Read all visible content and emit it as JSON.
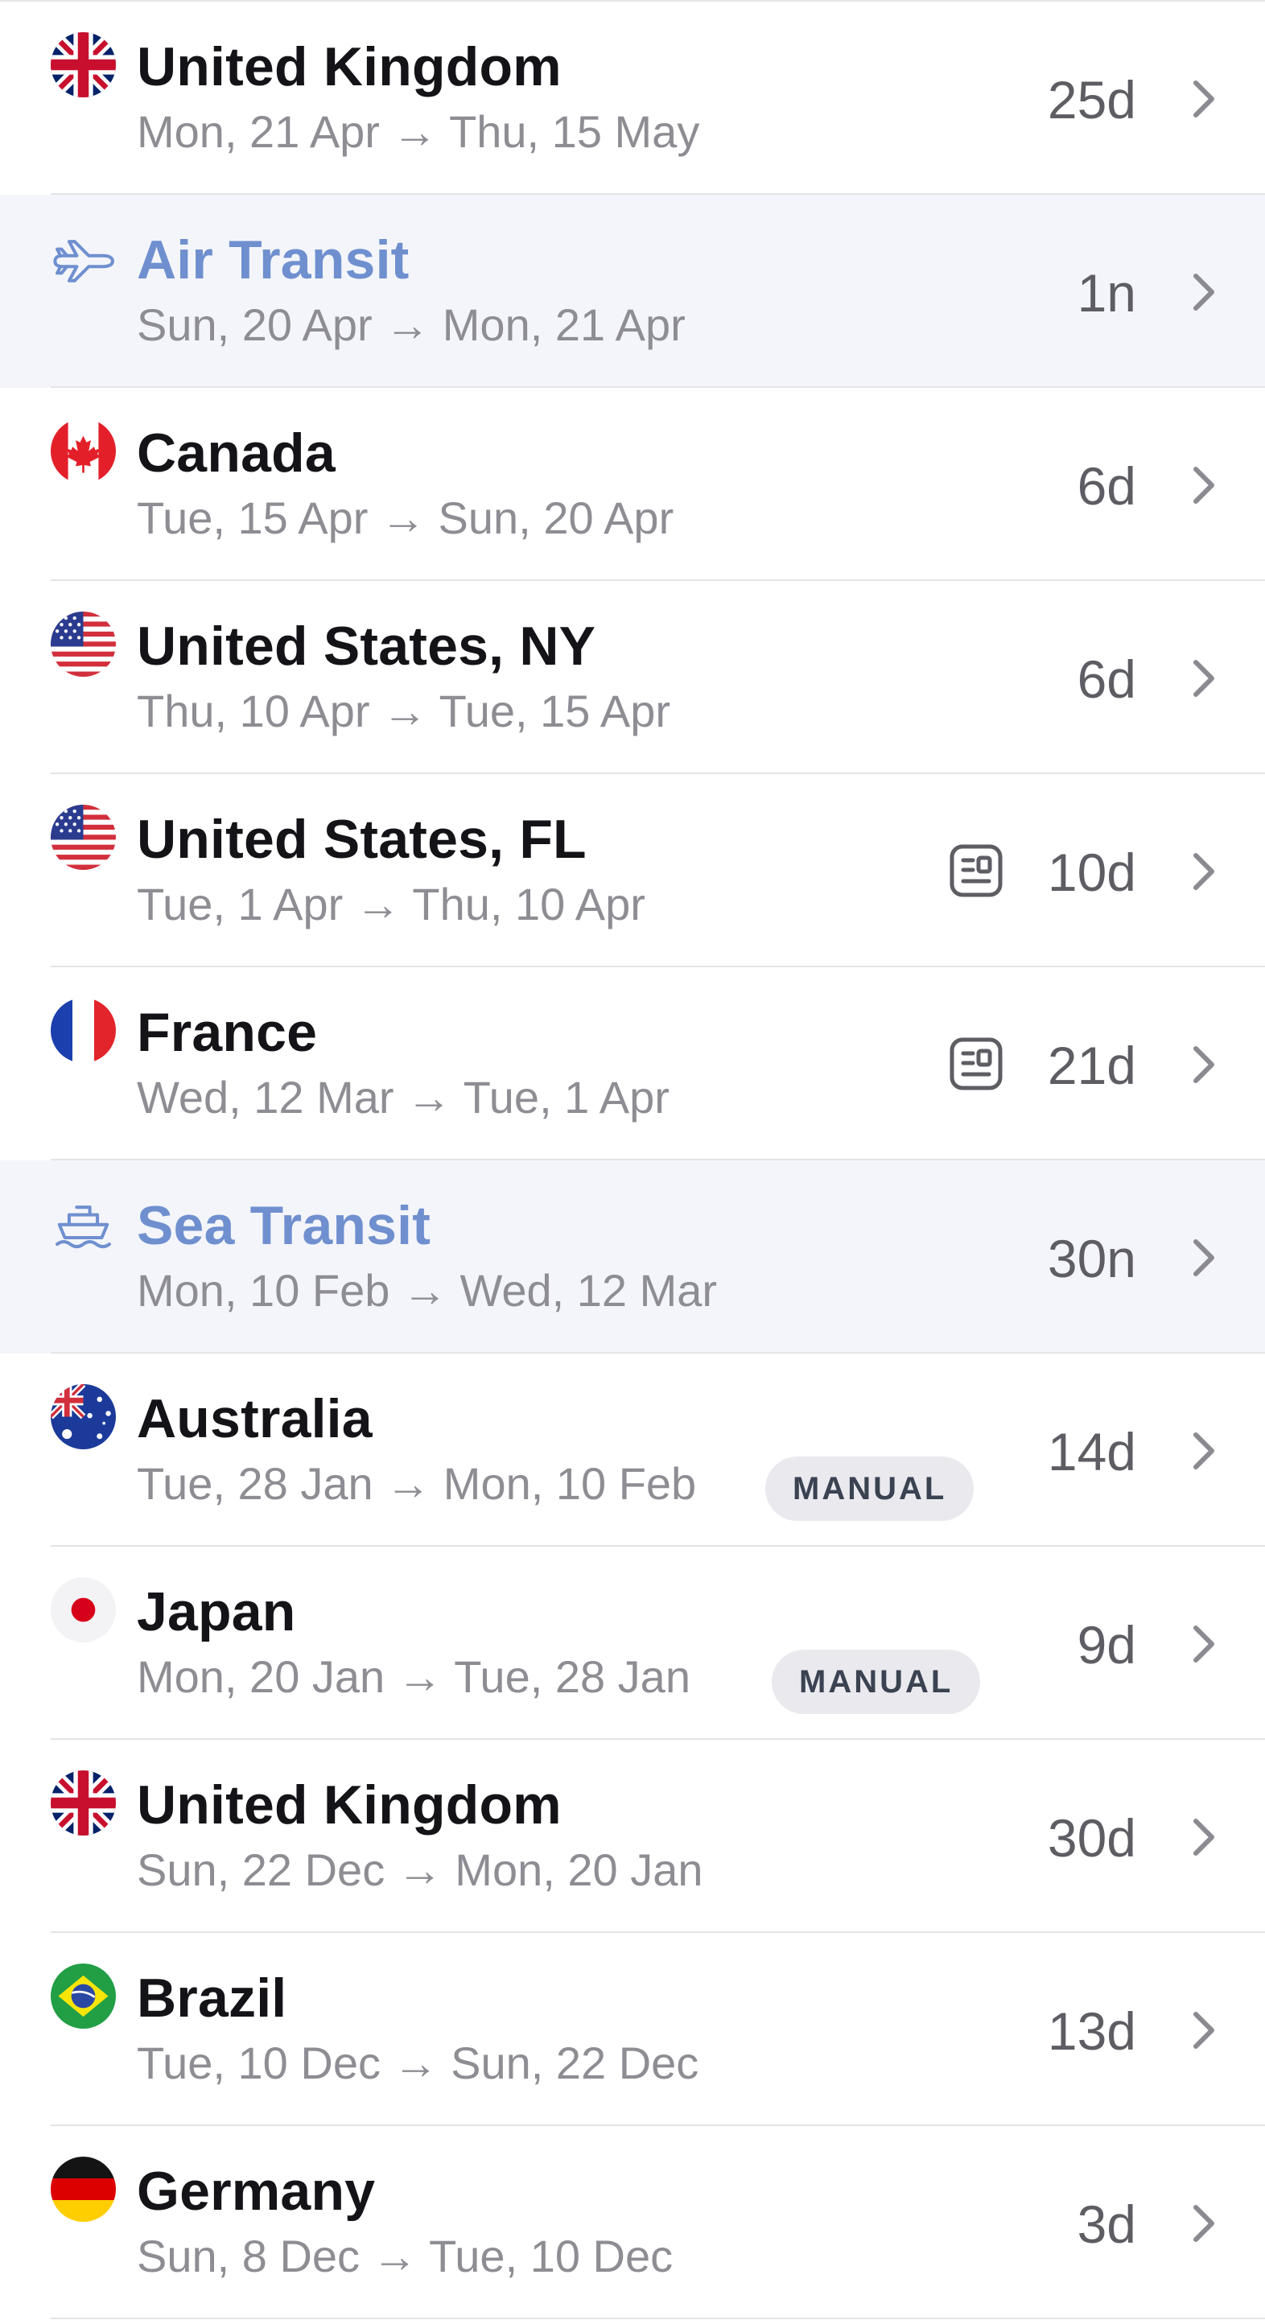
{
  "trips": [
    {
      "kind": "country",
      "flag": "uk-flag",
      "title": "United Kingdom",
      "dates": "Mon, 21 Apr → Thu, 15 May",
      "duration": "25d"
    },
    {
      "kind": "transit",
      "icon": "airplane-icon",
      "title": "Air Transit",
      "dates": "Sun, 20 Apr → Mon, 21 Apr",
      "duration": "1n"
    },
    {
      "kind": "country",
      "flag": "canada-flag",
      "title": "Canada",
      "dates": "Tue, 15 Apr → Sun, 20 Apr",
      "duration": "6d"
    },
    {
      "kind": "country",
      "flag": "us-flag",
      "title": "United States, NY",
      "dates": "Thu, 10 Apr → Tue, 15 Apr",
      "duration": "6d"
    },
    {
      "kind": "country",
      "flag": "us-flag",
      "title": "United States, FL",
      "dates": "Tue, 1 Apr → Thu, 10 Apr",
      "duration": "10d",
      "icon": "receipt-icon"
    },
    {
      "kind": "country",
      "flag": "france-flag",
      "title": "France",
      "dates": "Wed, 12 Mar → Tue, 1 Apr",
      "duration": "21d",
      "icon": "receipt-icon"
    },
    {
      "kind": "transit",
      "icon": "ship-icon",
      "title": "Sea Transit",
      "dates": "Mon, 10 Feb → Wed, 12 Mar",
      "duration": "30n"
    },
    {
      "kind": "country",
      "flag": "australia-flag",
      "title": "Australia",
      "dates": "Tue, 28 Jan → Mon, 10 Feb",
      "duration": "14d",
      "badge": "MANUAL"
    },
    {
      "kind": "country",
      "flag": "japan-flag",
      "title": "Japan",
      "dates": "Mon, 20 Jan → Tue, 28 Jan",
      "duration": "9d",
      "badge": "MANUAL"
    },
    {
      "kind": "country",
      "flag": "uk-flag",
      "title": "United Kingdom",
      "dates": "Sun, 22 Dec → Mon, 20 Jan",
      "duration": "30d"
    },
    {
      "kind": "country",
      "flag": "brazil-flag",
      "title": "Brazil",
      "dates": "Tue, 10 Dec → Sun, 22 Dec",
      "duration": "13d"
    },
    {
      "kind": "country",
      "flag": "germany-flag",
      "title": "Germany",
      "dates": "Sun, 8 Dec → Tue, 10 Dec",
      "duration": "3d"
    }
  ],
  "colors": {
    "transit_text": "#6f8fcf",
    "transit_background": "#f3f5fa",
    "title_text": "#141418",
    "secondary_text": "#8d8d93",
    "badge_background": "#e9e9ee"
  }
}
